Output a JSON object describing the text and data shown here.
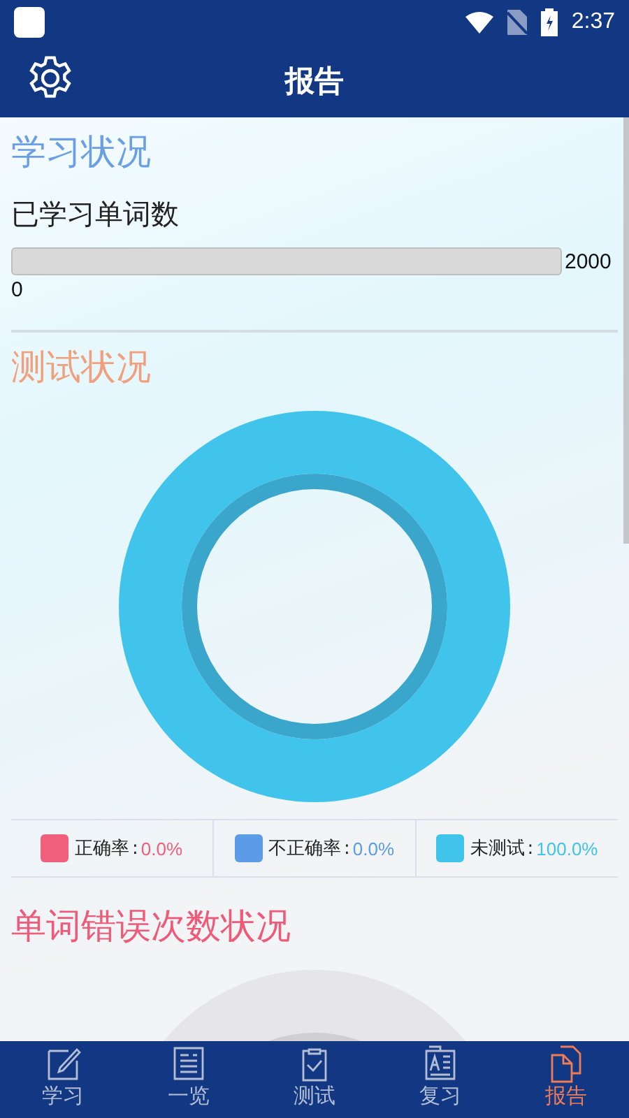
{
  "status_bar": {
    "time": "2:37"
  },
  "header": {
    "title": "报告"
  },
  "study": {
    "heading": "学习状况",
    "label": "已学习单词数",
    "level": 0,
    "max": "2000",
    "min": "0"
  },
  "test": {
    "heading": "测试状况",
    "legend_separator": ":",
    "chart_data": {
      "type": "donut",
      "categories": [
        "正确率",
        "不正确率",
        "未测试"
      ],
      "values": [
        0,
        0,
        100
      ],
      "value_labels": [
        "0.0%",
        "0.0%",
        "100.0%"
      ],
      "colors": [
        "#f0607a",
        "#5b9be8",
        "#40c4ec"
      ]
    }
  },
  "errors": {
    "heading": "单词错误次数状况"
  },
  "tabs": [
    {
      "label": "学习",
      "kind": "pencil",
      "selected": false
    },
    {
      "label": "一览",
      "kind": "list",
      "selected": false
    },
    {
      "label": "测试",
      "kind": "clipboard",
      "selected": false
    },
    {
      "label": "复习",
      "kind": "card",
      "selected": false
    },
    {
      "label": "报告",
      "kind": "copy",
      "selected": true
    }
  ]
}
